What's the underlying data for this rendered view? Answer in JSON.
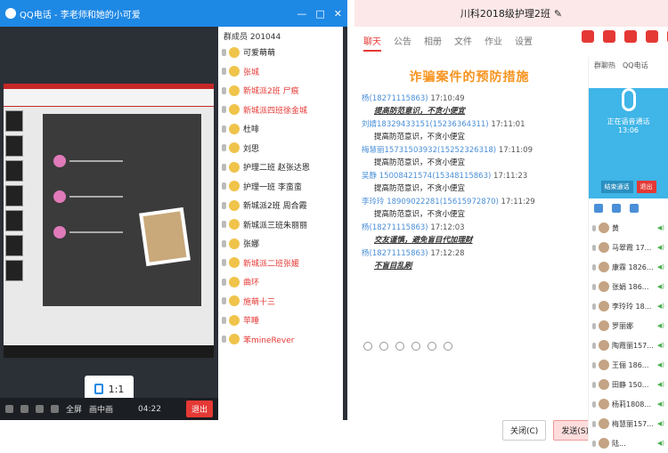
{
  "left_window": {
    "title": "QQ电话 - 李老师和她的小可爱",
    "members_header": "群成员 201044",
    "members": [
      {
        "name": "可爱萌萌",
        "color": "normal"
      },
      {
        "name": "张城",
        "color": "red"
      },
      {
        "name": "新城派2班 尸痕",
        "color": "red"
      },
      {
        "name": "新城派四班徐金城",
        "color": "red"
      },
      {
        "name": "杜啡",
        "color": "normal"
      },
      {
        "name": "刘思",
        "color": "normal"
      },
      {
        "name": "护理二班 赵张达恩",
        "color": "normal"
      },
      {
        "name": "护理一班 李蛮蛮",
        "color": "normal"
      },
      {
        "name": "新城派2班 周合霞",
        "color": "normal"
      },
      {
        "name": "新城派三班朱丽丽",
        "color": "normal"
      },
      {
        "name": "张娜",
        "color": "normal"
      },
      {
        "name": "新城派二班张媛",
        "color": "red"
      },
      {
        "name": "曲环",
        "color": "red"
      },
      {
        "name": "施萌十三",
        "color": "red"
      },
      {
        "name": "苹睡",
        "color": "red"
      },
      {
        "name": "苯mineRever",
        "color": "red"
      }
    ],
    "ratio_label": "1:1",
    "bottom_bar": [
      "全屏",
      "画中画"
    ],
    "timer": "04:22",
    "exit_label": "退出"
  },
  "right_window": {
    "title": "川科2018级护理2班",
    "tabs": [
      "聊天",
      "公告",
      "相册",
      "文件",
      "作业",
      "设置"
    ],
    "active_tab": "聊天",
    "chat_heading": "诈骗案件的预防措施",
    "messages": [
      {
        "sender": "杨(18271115863)",
        "time": "17:10:49",
        "text": "提高防范意识，不贪小便宜",
        "style": "underline"
      },
      {
        "sender": "刘婧18329433151(15236364311)",
        "time": "17:11:01",
        "text": "提高防范意识，不贪小便宜",
        "style": "plain"
      },
      {
        "sender": "梅慧丽15731503932(15252326318)",
        "time": "17:11:09",
        "text": "提高防范意识，不贪小便宜",
        "style": "plain"
      },
      {
        "sender": "吴静 15008421574(15348115863)",
        "time": "17:11:23",
        "text": "提高防范意识，不贪小便宜",
        "style": "plain"
      },
      {
        "sender": "李玲玲 18909022281(15615972870)",
        "time": "17:11:29",
        "text": "提高防范意识，不贪小便宜",
        "style": "plain"
      },
      {
        "sender": "杨(18271115863)",
        "time": "17:12:03",
        "text": "交友谨慎，避免盲目代加理财",
        "style": "underline"
      },
      {
        "sender": "杨(18271115863)",
        "time": "17:12:28",
        "text": "不盲目乱刷",
        "style": "underline"
      }
    ],
    "buttons": {
      "close": "关闭(C)",
      "send": "发送(S)"
    },
    "call_panel": {
      "tabs": [
        "群聊热",
        "QQ电话"
      ],
      "status": "正在语音通话",
      "time": "13:06",
      "end_label": "结束通话",
      "exit_label": "退出",
      "participants": [
        {
          "name": "黄"
        },
        {
          "name": "马翠霞 17..."
        },
        {
          "name": "康霖 1826..."
        },
        {
          "name": "张娟 186..."
        },
        {
          "name": "李玲玲 18..."
        },
        {
          "name": "罗丽娜"
        },
        {
          "name": "陶霞丽157..."
        },
        {
          "name": "王俪 186..."
        },
        {
          "name": "田静 150..."
        },
        {
          "name": "杨莉1808..."
        },
        {
          "name": "梅慧丽157..."
        },
        {
          "name": "陆..."
        }
      ]
    }
  },
  "colors": {
    "accent_blue": "#1e88e5",
    "accent_red": "#e53935",
    "heading_orange": "#f7931e",
    "call_blue": "#3fb5e8"
  }
}
